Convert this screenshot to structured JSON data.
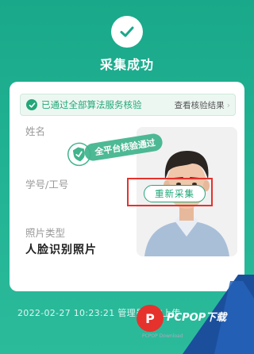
{
  "header": {
    "title": "采集成功",
    "icon": "check-icon"
  },
  "banner": {
    "text": "已通过全部算法服务核验",
    "link": "查看核验结果",
    "link_chevron": "›",
    "accent": "#22a779"
  },
  "fields": {
    "name_label": "姓名",
    "name_value": "",
    "id_label": "学号/工号",
    "id_value": "",
    "photo_type_label": "照片类型",
    "photo_type_value": "人脸识别照片"
  },
  "photo": {
    "stamp_text": "全平台核验通过"
  },
  "actions": {
    "retake_label": "重新采集"
  },
  "footer": {
    "text": "2022-02-27 10:23:21  管理员修改上传"
  },
  "watermark": {
    "text": "PCPOP下载",
    "sub": "PCPOP Download"
  },
  "colors": {
    "background": "#19a98a",
    "highlight": "#e5322d"
  }
}
